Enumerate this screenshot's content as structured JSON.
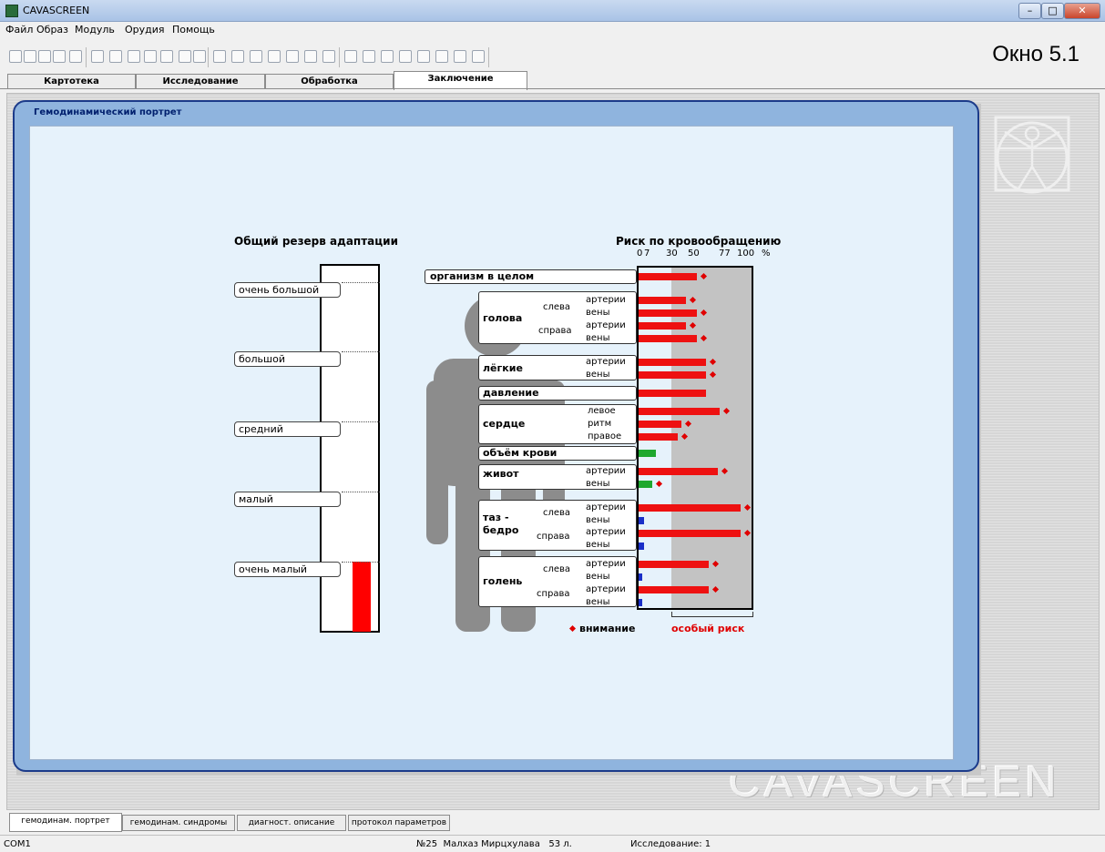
{
  "window": {
    "title": "CAVASCREEN",
    "label": "Окно 5.1"
  },
  "menu": [
    "Файл",
    "Образ",
    "Модуль",
    "Орудия",
    "Помощь"
  ],
  "tabs": [
    "Картотека",
    "Исследование",
    "Обработка",
    "Заключение"
  ],
  "active_tab": "Заключение",
  "panel": {
    "title": "Гемодинамический портрет"
  },
  "adaptation": {
    "title": "Общий резерв адаптации",
    "levels": [
      "очень большой",
      "большой",
      "средний",
      "малый",
      "очень малый"
    ],
    "current_level": "очень малый",
    "bar_color": "#ff0000"
  },
  "risk": {
    "title": "Риск по кровообращению",
    "ticks": [
      "0",
      "7",
      "30",
      "50",
      "77",
      "100"
    ],
    "unit": "%",
    "legend_attention": "внимание",
    "legend_risk": "особый риск",
    "colors": {
      "high": "#ee1111",
      "low": "#1a2fc8",
      "ok": "#1fa82f",
      "zone": "#c3c3c3"
    },
    "organs": {
      "whole": "организм в целом",
      "head": "голова",
      "lungs": "лёгкие",
      "pressure": "давление",
      "heart": "сердце",
      "blood_volume": "объём крови",
      "abdomen": "живот",
      "pelvis": "таз -\nбедро",
      "shin": "голень"
    },
    "sides": {
      "left": "слева",
      "right": "справа"
    },
    "vessels": {
      "arteries": "артерии",
      "veins": "вены"
    },
    "heart_parts": [
      "левое",
      "ритм",
      "правое"
    ],
    "chart_data": {
      "type": "bar",
      "xlim": [
        0,
        100
      ],
      "categories": [
        "организм в целом",
        "голова слева артерии",
        "голова слева вены",
        "голова справа артерии",
        "голова справа вены",
        "лёгкие артерии",
        "лёгкие вены",
        "давление",
        "сердце левое",
        "сердце ритм",
        "сердце правое",
        "объём крови",
        "живот артерии",
        "живот вены",
        "таз-бедро слева артерии",
        "таз-бедро слева вены",
        "таз-бедро справа артерии",
        "таз-бедро справа вены",
        "голень слева артерии",
        "голень слева вены",
        "голень справа артерии",
        "голень справа вены"
      ],
      "values": [
        52,
        42,
        52,
        42,
        52,
        60,
        60,
        60,
        72,
        38,
        35,
        15,
        70,
        12,
        90,
        5,
        90,
        5,
        62,
        3,
        62,
        3
      ],
      "attention": [
        true,
        true,
        true,
        true,
        true,
        true,
        true,
        false,
        true,
        true,
        true,
        false,
        true,
        true,
        true,
        false,
        true,
        false,
        true,
        false,
        true,
        false
      ],
      "level": [
        "high",
        "high",
        "high",
        "high",
        "high",
        "high",
        "high",
        "high",
        "high",
        "high",
        "high",
        "ok",
        "high",
        "ok",
        "high",
        "low",
        "high",
        "low",
        "high",
        "low",
        "high",
        "low"
      ]
    }
  },
  "bottom_tabs": [
    "гемодинам. портрет",
    "гемодинам. синдромы",
    "диагност. описание",
    "протокол параметров"
  ],
  "status": {
    "port": "COM1",
    "patient": "№25  Малхаз Мирцхулава   53 л.",
    "study": "Исследование: 1"
  },
  "watermark": "CAVASCREEN"
}
